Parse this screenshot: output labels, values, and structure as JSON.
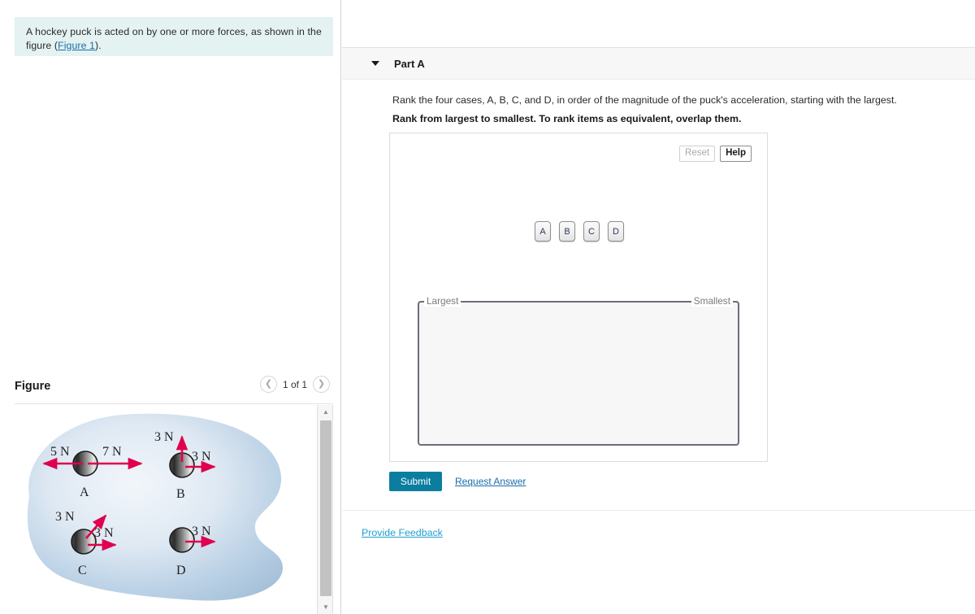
{
  "question": {
    "text_before_link": "A hockey puck is acted on by one or more forces, as shown in the figure (",
    "link_label": "Figure 1",
    "text_after_link": ")."
  },
  "figure_panel": {
    "title": "Figure",
    "counter": "1 of 1",
    "prev_icon": "chevron-left-icon",
    "next_icon": "chevron-right-icon",
    "scroll_up_icon": "triangle-up-icon",
    "scroll_down_icon": "triangle-down-icon"
  },
  "figure": {
    "caption_font": "serif",
    "rink_fill_light": "#e8eef6",
    "rink_fill_mid": "#a9c4dd",
    "arrow_color": "#e0004d",
    "cases": [
      {
        "label": "A",
        "forces": [
          {
            "magnitude": "5 N",
            "direction": "left"
          },
          {
            "magnitude": "7 N",
            "direction": "right"
          }
        ]
      },
      {
        "label": "B",
        "forces": [
          {
            "magnitude": "3 N",
            "direction": "up"
          },
          {
            "magnitude": "3 N",
            "direction": "right"
          }
        ]
      },
      {
        "label": "C",
        "forces": [
          {
            "magnitude": "3 N",
            "direction": "up-right-diagonal"
          },
          {
            "magnitude": "3 N",
            "direction": "right"
          }
        ]
      },
      {
        "label": "D",
        "forces": [
          {
            "magnitude": "3 N",
            "direction": "right"
          }
        ]
      }
    ]
  },
  "part": {
    "caret_icon": "caret-down-icon",
    "title": "Part A",
    "prompt": "Rank the four cases, A, B, C, and D, in order of the magnitude of the puck's acceleration, starting with the largest.",
    "instruction": "Rank from largest to smallest. To rank items as equivalent, overlap them."
  },
  "ranking_widget": {
    "reset_label": "Reset",
    "help_label": "Help",
    "items": [
      "A",
      "B",
      "C",
      "D"
    ],
    "zone_left_label": "Largest",
    "zone_right_label": "Smallest"
  },
  "actions": {
    "submit_label": "Submit",
    "request_answer_label": "Request Answer",
    "provide_feedback_label": "Provide Feedback"
  },
  "colors": {
    "submit_bg": "#0b7ea0",
    "link": "#1b6ca8",
    "question_bg": "#e4f2f1",
    "feedback_link": "#1f9ed1"
  }
}
